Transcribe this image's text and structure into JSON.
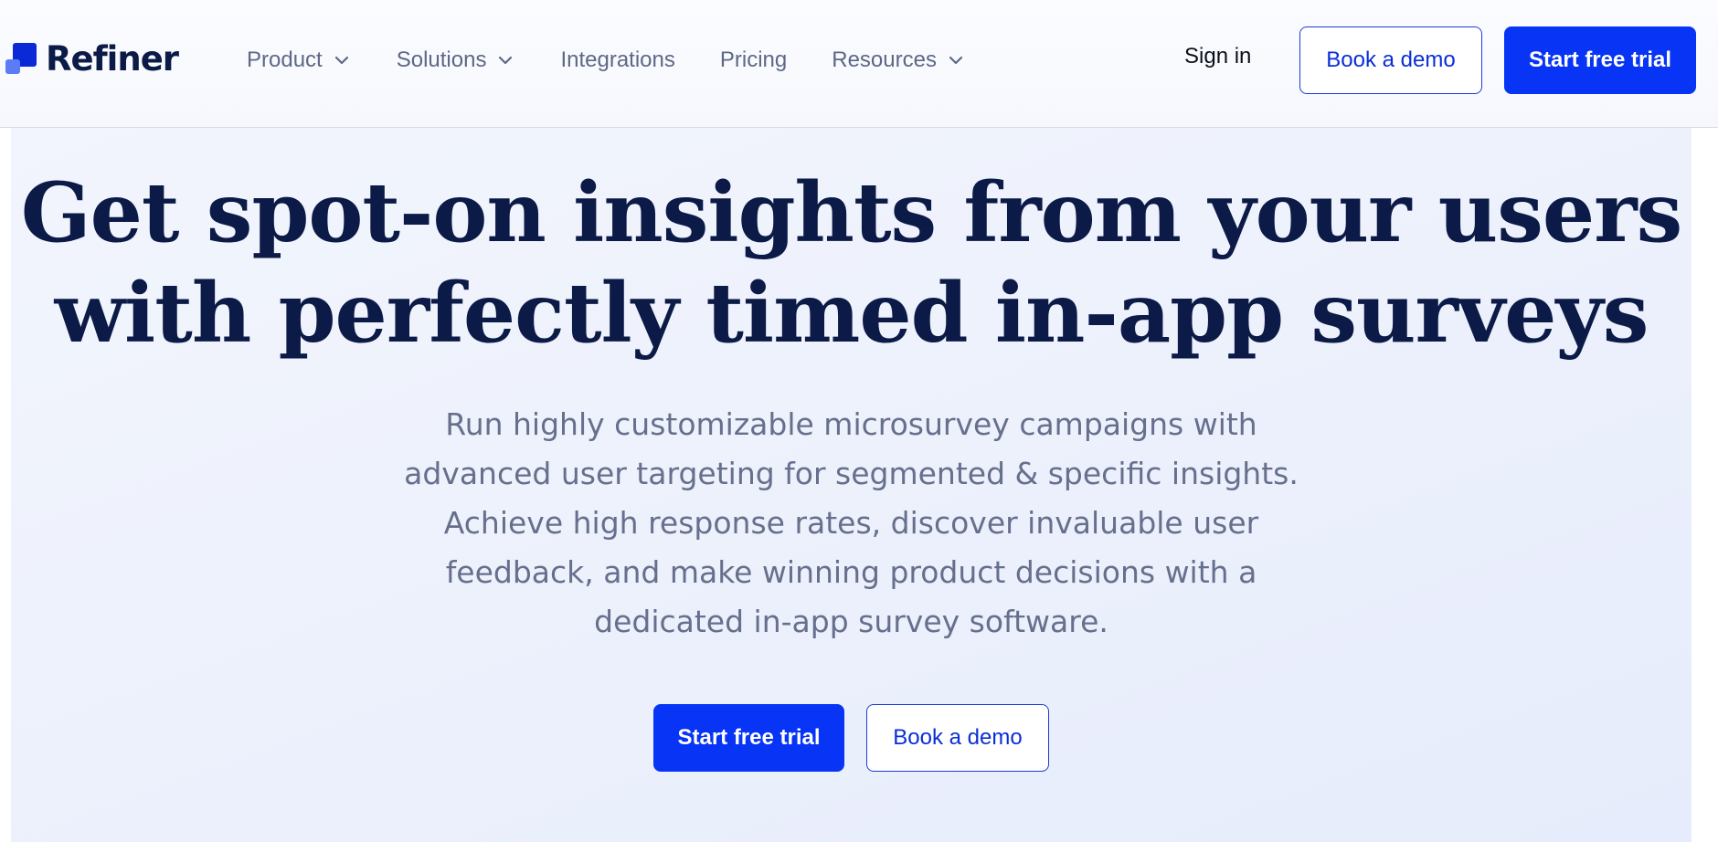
{
  "brand": {
    "name": "Refiner",
    "primary_color": "#0734f5",
    "logo_dark": "#0a2ad8",
    "logo_light": "#5c7cf5",
    "text_dark": "#0b1a46"
  },
  "nav": {
    "items": [
      {
        "label": "Product",
        "has_dropdown": true
      },
      {
        "label": "Solutions",
        "has_dropdown": true
      },
      {
        "label": "Integrations",
        "has_dropdown": false
      },
      {
        "label": "Pricing",
        "has_dropdown": false
      },
      {
        "label": "Resources",
        "has_dropdown": true
      }
    ],
    "signin_label": "Sign in",
    "demo_label": "Book a demo",
    "trial_label": "Start free trial"
  },
  "hero": {
    "title_line1": "Get spot-on insights from your users",
    "title_line2": "with perfectly timed in-app surveys",
    "subtitle": "Run highly customizable microsurvey campaigns with advanced user targeting for segmented & specific insights. Achieve high response rates, discover invaluable user feedback, and make winning product decisions with a dedicated in-app survey software.",
    "cta_trial_label": "Start free trial",
    "cta_demo_label": "Book a demo"
  }
}
